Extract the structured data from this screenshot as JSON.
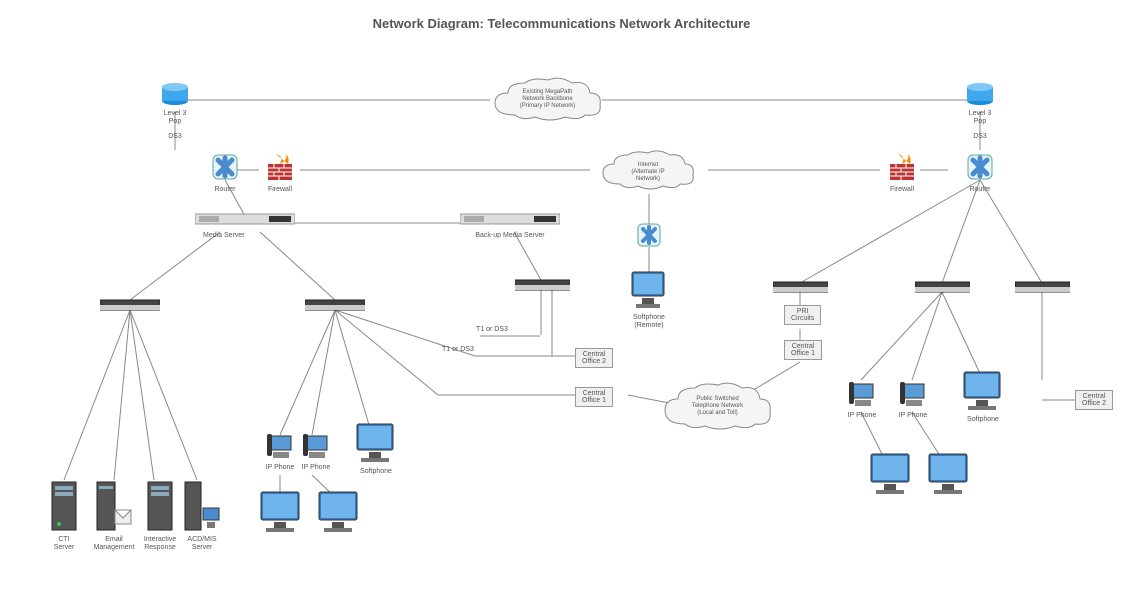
{
  "title": "Network Diagram: Telecommunications Network Architecture",
  "clouds": {
    "backbone": "Existing MegaPath\nNetwork Backbone\n(Primary IP Network)",
    "internet": "Internet\n(Alternate IP\nNetwork)",
    "pstn": "Public Switched\nTelephone Network\n(Local and Toll)"
  },
  "nodes": {
    "pop_left": "Level 3 Pop",
    "pop_right": "Level 3 Pop",
    "ds3_left": "DS3",
    "ds3_right": "DS3",
    "router_left": "Router",
    "router_right": "Router",
    "firewall_left": "Firewall",
    "firewall_right": "Firewall",
    "media_server": "Media Server",
    "backup_media": "Back-up Media Server",
    "softphone_remote": "Softphone\n(Remote)",
    "pri_circuits": "PRI\nCircuits",
    "central_office_1a": "Central\nOffice 1",
    "central_office_1b": "Central\nOffice 1",
    "central_office_2a": "Central\nOffice 2",
    "central_office_2b": "Central\nOffice 2",
    "t1_ds3_a": "T1 or DS3",
    "t1_ds3_b": "T1 or DS3",
    "cti_server": "CTI\nServer",
    "email_mgmt": "Email\nManagement",
    "ivr": "Interactive\nResponse",
    "acdms": "ACD/MIS\nServer",
    "ip_phone": "IP Phone",
    "softphone": "Softphone"
  }
}
